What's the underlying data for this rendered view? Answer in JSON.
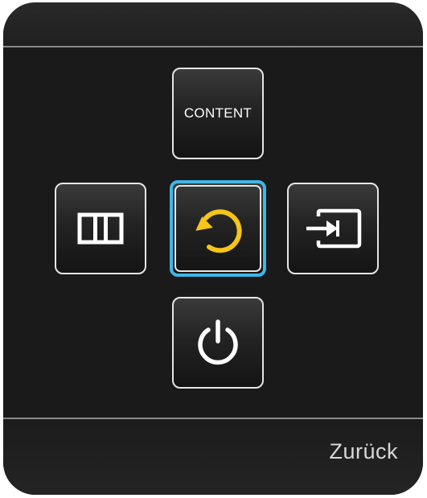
{
  "panel": {
    "buttons": {
      "content": {
        "label": "CONTENT",
        "icon": "content-text"
      },
      "menu": {
        "icon": "menu-icon"
      },
      "return": {
        "icon": "return-icon",
        "selected": true,
        "icon_color": "#f5c518"
      },
      "source": {
        "icon": "source-input-icon"
      },
      "power": {
        "icon": "power-icon"
      }
    },
    "footer": {
      "back_label": "Zurück"
    },
    "colors": {
      "panel_bg": "#1a1a1a",
      "selection_border": "#3fb7e6",
      "return_icon": "#f5c518",
      "icon": "#ffffff"
    }
  }
}
